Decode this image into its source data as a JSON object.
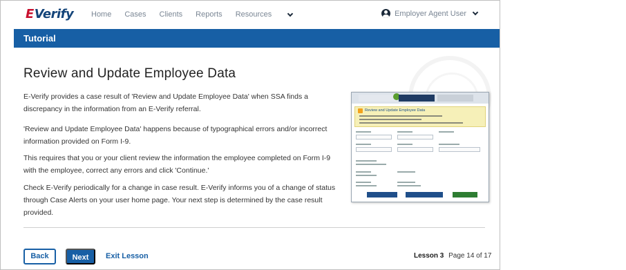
{
  "nav": {
    "logo_e": "E",
    "logo_verify": "Verify",
    "links": [
      "Home",
      "Cases",
      "Clients",
      "Reports",
      "Resources"
    ],
    "user_label": "Employer Agent User"
  },
  "tutorial_bar": "Tutorial",
  "content": {
    "title": "Review and Update Employee Data",
    "paragraphs": [
      "E-Verify provides a case result of 'Review and Update Employee Data' when SSA finds a discrepancy in the information from an E-Verify referral.",
      "'Review and Update Employee Data' happens because of typographical errors and/or incorrect information provided on Form I-9.",
      "This requires that you or your client review the information the employee completed on Form I-9 with the employee, correct any errors and click 'Continue.'",
      "Check E-Verify periodically for a change in case result. E-Verify informs you of a change of status through Case Alerts on your user home page. Your next step is determined by the case result provided."
    ],
    "screenshot_alert_title": "Review and Update Employee Data"
  },
  "footer": {
    "back_label": "Back",
    "next_label": "Next",
    "exit_label": "Exit Lesson",
    "lesson_label": "Lesson 3",
    "page_label": "Page 14 of 17"
  },
  "colors": {
    "brand_blue": "#175fa5",
    "logo_red": "#c8102e",
    "logo_navy": "#15457a"
  },
  "icons": [
    "chevron-down-icon",
    "user-circle-icon",
    "dhs-seal-watermark"
  ]
}
